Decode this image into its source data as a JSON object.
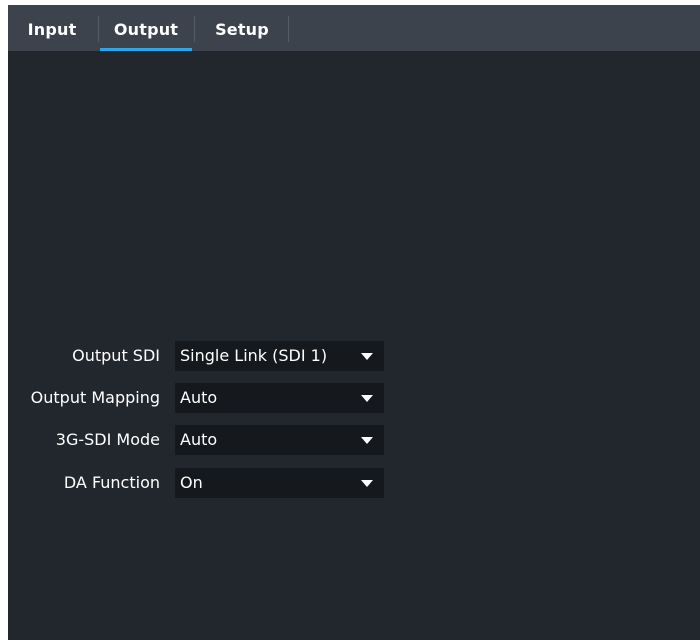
{
  "tabs": [
    {
      "label": "Input",
      "active": false
    },
    {
      "label": "Output",
      "active": true
    },
    {
      "label": "Setup",
      "active": false
    }
  ],
  "settings": [
    {
      "label": "Output SDI",
      "value": "Single Link (SDI 1)"
    },
    {
      "label": "Output Mapping",
      "value": "Auto"
    },
    {
      "label": "3G-SDI Mode",
      "value": "Auto"
    },
    {
      "label": "DA Function",
      "value": "On"
    }
  ],
  "colors": {
    "background": "#22262d",
    "tabbar": "#3d434d",
    "accent": "#2fa5e8",
    "select_bg": "#15181d"
  }
}
